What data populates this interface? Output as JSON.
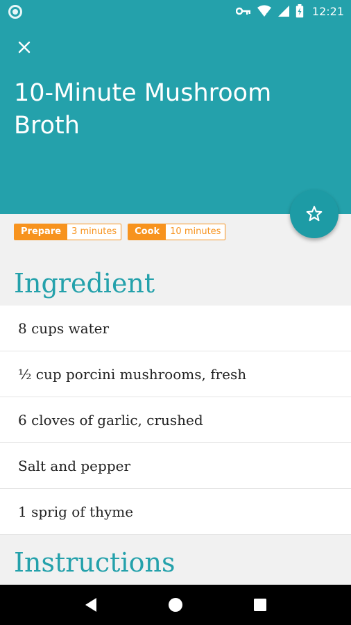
{
  "status_bar": {
    "time": "12:21",
    "icons": [
      "circle-indicator-icon",
      "vpn-key-icon",
      "wifi-icon",
      "signal-icon",
      "battery-icon"
    ]
  },
  "header": {
    "close_icon": "close-icon",
    "title": "10-Minute Mushroom Broth",
    "favorite_icon": "star-outline-icon"
  },
  "times": [
    {
      "label": "Prepare",
      "value": "3 minutes"
    },
    {
      "label": "Cook",
      "value": "10 minutes"
    }
  ],
  "ingredients": {
    "heading": "Ingredient",
    "items": [
      "8 cups water",
      "½ cup porcini mushrooms, fresh",
      "6 cloves of garlic, crushed",
      "Salt and pepper",
      "1 sprig of thyme"
    ]
  },
  "instructions": {
    "heading": "Instructions"
  },
  "nav_bar": {
    "icons": [
      "back-icon",
      "home-icon",
      "recents-icon"
    ]
  },
  "colors": {
    "primary": "#24a1ab",
    "accent": "#f7931e",
    "background": "#f1f1f1"
  }
}
